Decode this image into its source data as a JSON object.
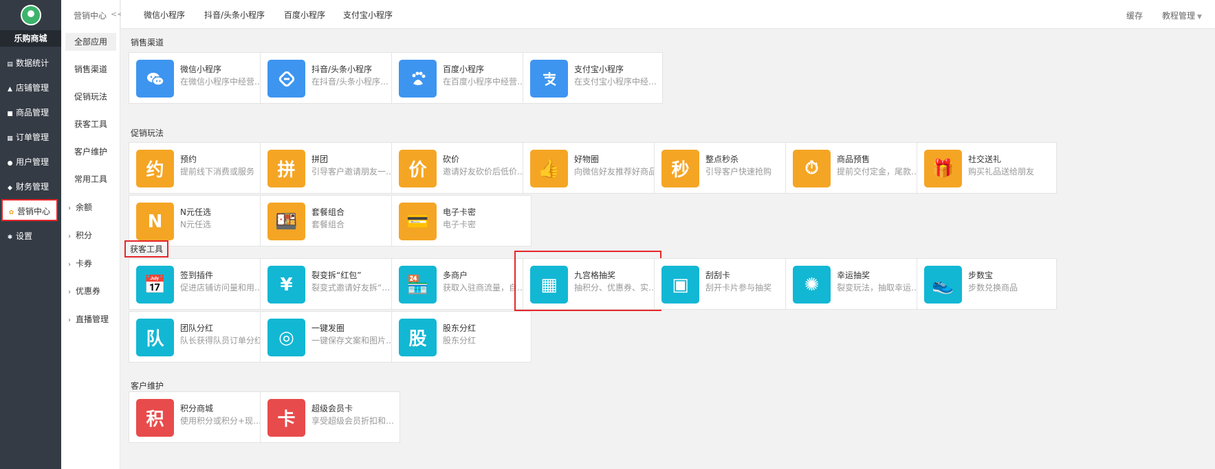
{
  "nav": {
    "shop_name": "乐购商城",
    "items": [
      {
        "label": "数据统计",
        "icon": "chart-icon"
      },
      {
        "label": "店铺管理",
        "icon": "store-icon"
      },
      {
        "label": "商品管理",
        "icon": "goods-icon"
      },
      {
        "label": "订单管理",
        "icon": "order-icon"
      },
      {
        "label": "用户管理",
        "icon": "user-icon"
      },
      {
        "label": "财务管理",
        "icon": "finance-icon"
      },
      {
        "label": "营销中心",
        "icon": "marketing-icon"
      },
      {
        "label": "设置",
        "icon": "gear-icon"
      }
    ]
  },
  "subnav": {
    "title": "营销中心",
    "collapse": "<<",
    "items": [
      "全部应用",
      "销售渠道",
      "促销玩法",
      "获客工具",
      "客户维护",
      "常用工具"
    ],
    "groups": [
      "余额",
      "积分",
      "卡券",
      "优惠券",
      "直播管理"
    ]
  },
  "topbar": {
    "tabs": [
      "微信小程序",
      "抖音/头条小程序",
      "百度小程序",
      "支付宝小程序"
    ],
    "cache": "缓存",
    "tutorial": "教程管理"
  },
  "sections": {
    "sales": {
      "title": "销售渠道",
      "cards": [
        {
          "title": "微信小程序",
          "desc": "在微信小程序中经营店铺",
          "icon": "wechat-icon"
        },
        {
          "title": "抖音/头条小程序",
          "desc": "在抖音/头条小程序中经营店铺",
          "icon": "douyin-icon"
        },
        {
          "title": "百度小程序",
          "desc": "在百度小程序中经营店铺",
          "icon": "baidu-icon"
        },
        {
          "title": "支付宝小程序",
          "desc": "在支付宝小程序中经营店铺",
          "icon": "alipay-icon"
        }
      ]
    },
    "promo": {
      "title": "促销玩法",
      "cards": [
        {
          "title": "预约",
          "desc": "提前线下消费或服务",
          "icon": "reserve-icon",
          "glyph": "约"
        },
        {
          "title": "拼团",
          "desc": "引导客户邀请朋友一起拼团购买",
          "icon": "group-buy-icon",
          "glyph": "拼"
        },
        {
          "title": "砍价",
          "desc": "邀请好友砍价后低价购买",
          "icon": "bargain-icon",
          "glyph": "价"
        },
        {
          "title": "好物圈",
          "desc": "向微信好友推荐好商品",
          "icon": "good-circle-icon",
          "glyph": "👍"
        },
        {
          "title": "整点秒杀",
          "desc": "引导客户快速抢购",
          "icon": "flash-sale-icon",
          "glyph": "秒"
        },
        {
          "title": "商品预售",
          "desc": "提前交付定金，尾款后付",
          "icon": "presale-icon",
          "glyph": "⏱"
        },
        {
          "title": "社交送礼",
          "desc": "购买礼品送给朋友",
          "icon": "gift-icon",
          "glyph": "🎁"
        },
        {
          "title": "N元任选",
          "desc": "N元任选",
          "icon": "n-yuan-icon",
          "glyph": "N"
        },
        {
          "title": "套餐组合",
          "desc": "套餐组合",
          "icon": "combo-icon",
          "glyph": "🍱"
        },
        {
          "title": "电子卡密",
          "desc": "电子卡密",
          "icon": "ecard-icon",
          "glyph": "💳"
        }
      ]
    },
    "acquire": {
      "title": "获客工具",
      "cards": [
        {
          "title": "签到插件",
          "desc": "促进店铺访问量和用户活跃",
          "icon": "checkin-icon",
          "glyph": "📅"
        },
        {
          "title": "裂变拆“红包”",
          "desc": "裂变式邀请好友拆“红包”",
          "icon": "red-packet-icon",
          "glyph": "¥"
        },
        {
          "title": "多商户",
          "desc": "获取入驻商流量，自营多商户",
          "icon": "multi-store-icon",
          "glyph": "🏪"
        },
        {
          "title": "九宫格抽奖",
          "desc": "抽积分、优惠券、实物奖品",
          "icon": "nine-grid-icon",
          "glyph": "▦"
        },
        {
          "title": "刮刮卡",
          "desc": "刮开卡片参与抽奖",
          "icon": "scratch-card-icon",
          "glyph": "▣"
        },
        {
          "title": "幸运抽奖",
          "desc": "裂变玩法，抽取幸运奖品",
          "icon": "lucky-wheel-icon",
          "glyph": "✺"
        },
        {
          "title": "步数宝",
          "desc": "步数兑换商品",
          "icon": "shoe-icon",
          "glyph": "👟"
        },
        {
          "title": "团队分红",
          "desc": "队长获得队员订单分红",
          "icon": "team-bonus-icon",
          "glyph": "队"
        },
        {
          "title": "一键发圈",
          "desc": "一键保存文案和图片发朋友圈",
          "icon": "moments-icon",
          "glyph": "◎"
        },
        {
          "title": "股东分红",
          "desc": "股东分红",
          "icon": "shareholder-icon",
          "glyph": "股"
        }
      ]
    },
    "maintain": {
      "title": "客户维护",
      "cards": [
        {
          "title": "积分商城",
          "desc": "使用积分或积分+现金兑换商品",
          "icon": "points-mall-icon",
          "glyph": "积"
        },
        {
          "title": "超级会员卡",
          "desc": "享受超级会员折扣和权益",
          "icon": "vip-card-icon",
          "glyph": "卡"
        }
      ]
    }
  }
}
